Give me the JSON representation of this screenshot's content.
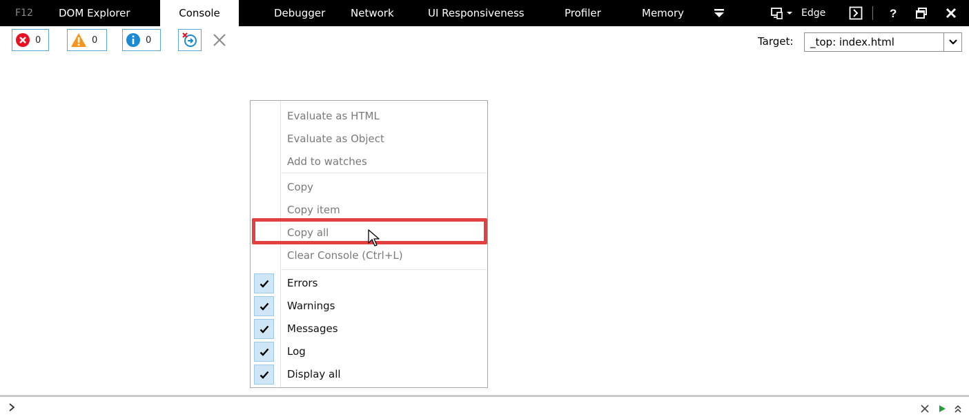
{
  "tabs": {
    "f12": "F12",
    "items": [
      {
        "label": "DOM Explorer"
      },
      {
        "label": "Console"
      },
      {
        "label": "Debugger"
      },
      {
        "label": "Network"
      },
      {
        "label": "UI Responsiveness"
      },
      {
        "label": "Profiler"
      },
      {
        "label": "Memory"
      }
    ],
    "active": "Console",
    "emulation_label": "Edge"
  },
  "toolbar": {
    "errors_count": "0",
    "warnings_count": "0",
    "info_count": "0",
    "target_label": "Target:",
    "target_value": "_top: index.html"
  },
  "context_menu": {
    "items": [
      {
        "label": "Evaluate as HTML",
        "enabled": false
      },
      {
        "label": "Evaluate as Object",
        "enabled": false
      },
      {
        "label": "Add to watches",
        "enabled": false
      },
      {
        "label": "Copy",
        "enabled": false
      },
      {
        "label": "Copy item",
        "enabled": false
      },
      {
        "label": "Copy all",
        "enabled": false,
        "highlighted": true
      },
      {
        "label": "Clear Console (Ctrl+L)",
        "enabled": false
      },
      {
        "label": "Errors",
        "checked": true
      },
      {
        "label": "Warnings",
        "checked": true
      },
      {
        "label": "Messages",
        "checked": true
      },
      {
        "label": "Log",
        "checked": true
      },
      {
        "label": "Display all",
        "checked": true
      }
    ]
  },
  "colors": {
    "tabbar_bg": "#000000",
    "accent_border": "#5aa6d6",
    "error_red": "#e81123",
    "warning_orange": "#f7941d",
    "info_blue": "#1a8ad4",
    "highlight_red": "#e2413f",
    "run_green": "#1f9e3a"
  },
  "icons": [
    "error-icon",
    "warning-icon",
    "info-icon",
    "break-on-navigate-icon",
    "clear-icon",
    "dropdown-arrow-icon",
    "emulation-icon",
    "console-toggle-icon",
    "help-icon",
    "undock-icon",
    "close-icon",
    "checkmark-icon",
    "prompt-icon",
    "run-icon",
    "expand-icon"
  ]
}
